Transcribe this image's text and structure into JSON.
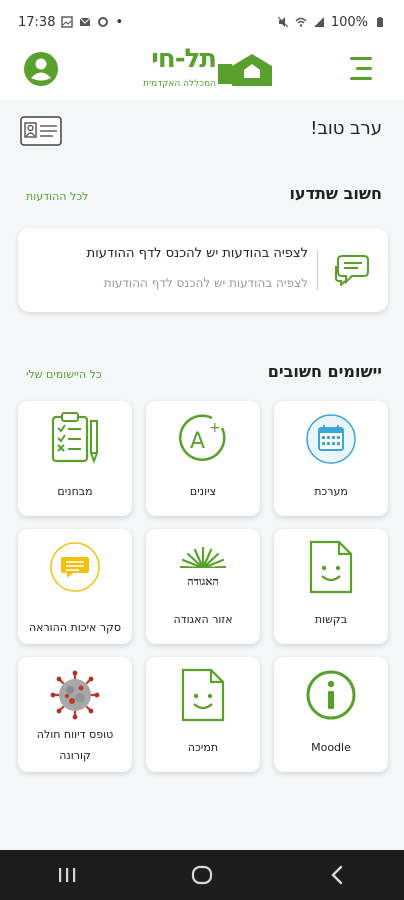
{
  "status_bar": {
    "time": "17:38",
    "battery": "100%",
    "dot": "•"
  },
  "header": {
    "logo_name": "תל-חי",
    "logo_subtitle": "המכללה האקדמית",
    "brand_color": "#5aa02c"
  },
  "greeting": "ערב טוב!",
  "notices": {
    "title": "חשוב שתדעו",
    "link": "לכל ההודעות",
    "card_title": "לצפיה בהודעות יש להכנס לדף ההודעות",
    "card_subtitle": "לצפיה בהודעות יש להכנס לדף ההודעות"
  },
  "apps": {
    "title": "יישומים חשובים",
    "link": "כל היישומים שלי",
    "tiles": [
      {
        "label": "מערכת",
        "icon": "calendar-icon"
      },
      {
        "label": "ציונים",
        "icon": "grade-a-plus-icon"
      },
      {
        "label": "מבחנים",
        "icon": "clipboard-checklist-icon"
      },
      {
        "label": "בקשות",
        "icon": "smiley-document-icon"
      },
      {
        "label": "אזור האגודה",
        "icon": "student-union-logo-icon"
      },
      {
        "label": "סקר איכות ההוראה",
        "icon": "survey-chat-icon"
      },
      {
        "label": "Moodle",
        "icon": "info-icon"
      },
      {
        "label": "תמיכה",
        "icon": "smiley-document-icon"
      },
      {
        "label": "טופס דיווח חולה קורונה",
        "icon": "coronavirus-icon"
      }
    ]
  },
  "union_logo_text": "האגודה"
}
